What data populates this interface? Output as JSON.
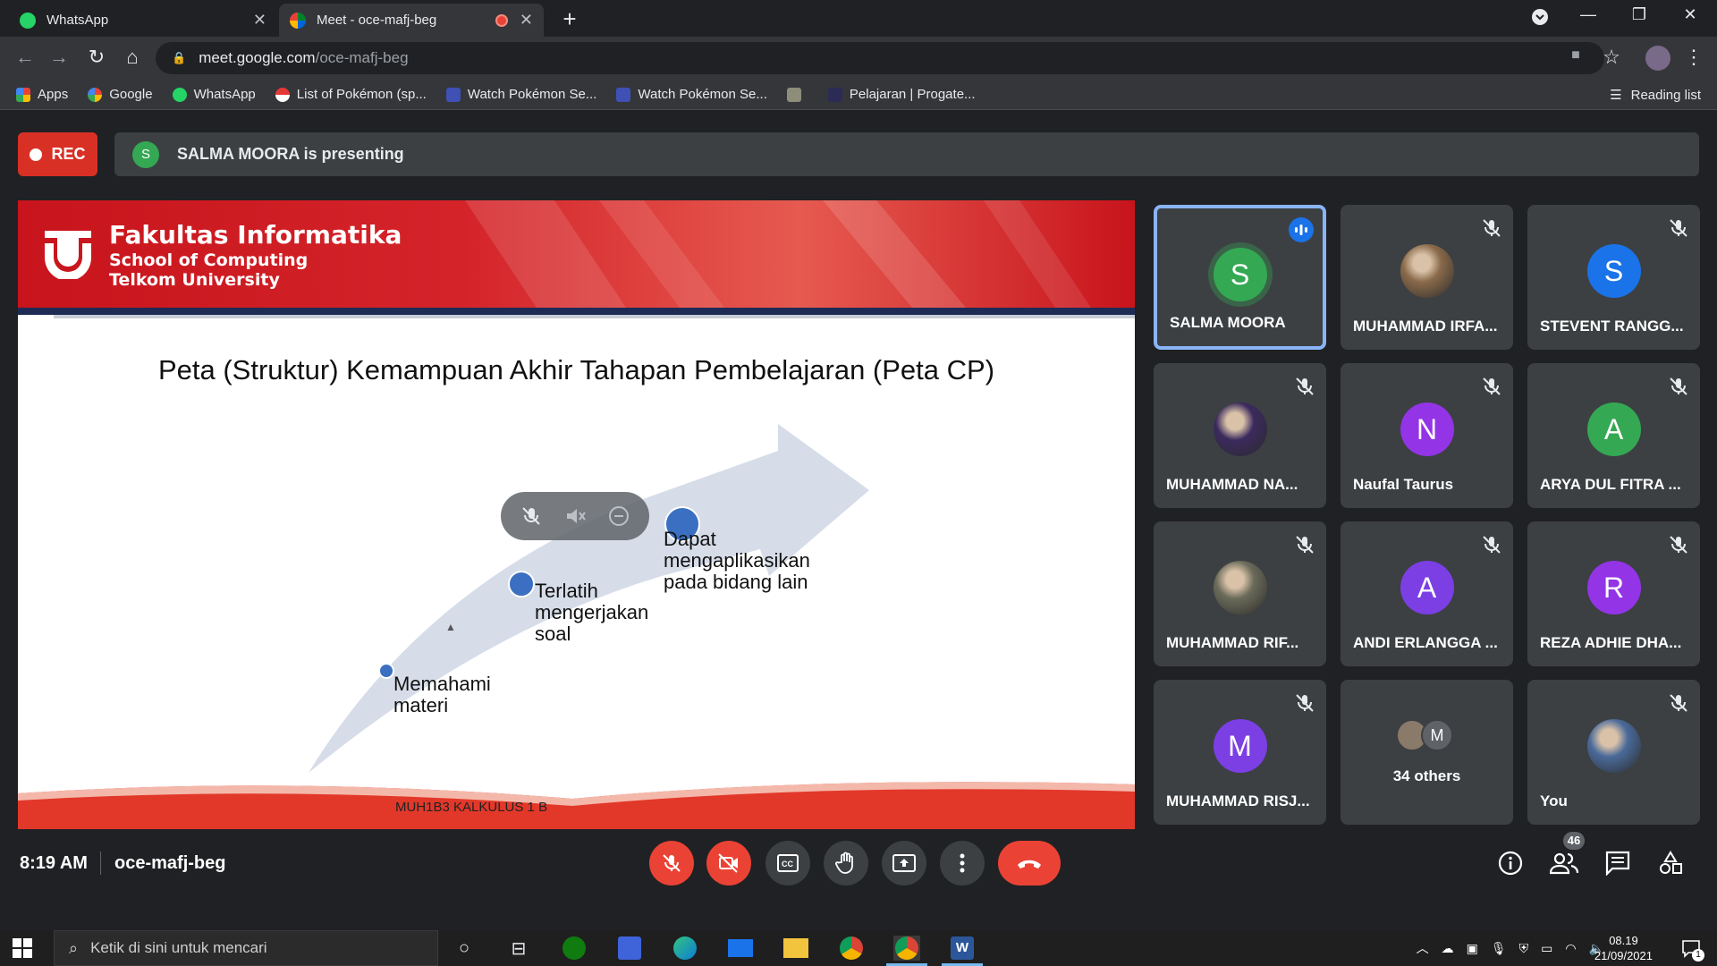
{
  "browser": {
    "tabs": [
      {
        "title": "WhatsApp",
        "active": false
      },
      {
        "title": "Meet - oce-mafj-beg",
        "active": true
      }
    ],
    "url_host": "meet.google.com",
    "url_path": "/oce-mafj-beg",
    "bookmarks": [
      {
        "label": "Apps",
        "icon": "apps-grid-icon"
      },
      {
        "label": "Google",
        "icon": "google-icon"
      },
      {
        "label": "WhatsApp",
        "icon": "whatsapp-icon"
      },
      {
        "label": "List of Pokémon (sp...",
        "icon": "pokeball-icon"
      },
      {
        "label": "Watch Pokémon Se...",
        "icon": "pokemon-tv-icon"
      },
      {
        "label": "Watch Pokémon Se...",
        "icon": "pokemon-tv-icon"
      },
      {
        "label": "",
        "icon": "image-favicon"
      },
      {
        "label": "Pelajaran | Progate...",
        "icon": "progate-icon"
      }
    ],
    "reading_list": "Reading list"
  },
  "meet": {
    "rec_label": "REC",
    "presenter_initial": "S",
    "presenting_text": "SALMA MOORA is presenting",
    "slide": {
      "faculty": "Fakultas Informatika",
      "school": "School of Computing",
      "university": "Telkom University",
      "title": "Peta (Struktur) Kemampuan Akhir Tahapan Pembelajaran (Peta CP)",
      "step1": [
        "Memahami",
        "materi"
      ],
      "step2": [
        "Terlatih",
        "mengerjakan",
        "soal"
      ],
      "step3": [
        "Dapat",
        "mengaplikasikan",
        "pada bidang lain"
      ],
      "footer": "MUH1B3 KALKULUS 1 B"
    },
    "participants": [
      {
        "name": "SALMA MOORA",
        "initial": "S",
        "color": "#34a853",
        "speaking": true
      },
      {
        "name": "MUHAMMAD IRFA...",
        "initial": "",
        "color": "#8a6a4a",
        "photo": true
      },
      {
        "name": "STEVENT RANGG...",
        "initial": "S",
        "color": "#1a73e8"
      },
      {
        "name": "MUHAMMAD NA...",
        "initial": "",
        "color": "#3b2a5e",
        "photo": true
      },
      {
        "name": "Naufal Taurus",
        "initial": "N",
        "color": "#9334e6"
      },
      {
        "name": "ARYA DUL FITRA ...",
        "initial": "A",
        "color": "#34a853"
      },
      {
        "name": "MUHAMMAD RIF...",
        "initial": "",
        "color": "#6b6b5a",
        "photo": true
      },
      {
        "name": "ANDI ERLANGGA ...",
        "initial": "A",
        "color": "#7b3fe4"
      },
      {
        "name": "REZA ADHIE DHA...",
        "initial": "R",
        "color": "#9334e6"
      },
      {
        "name": "MUHAMMAD RISJ...",
        "initial": "M",
        "color": "#7b3fe4"
      },
      {
        "name": "34 others",
        "initial": "M",
        "color": "#5f6368",
        "others": true
      },
      {
        "name": "You",
        "initial": "",
        "color": "#4a6a9a",
        "photo": true
      }
    ],
    "time": "8:19 AM",
    "meeting_code": "oce-mafj-beg",
    "participant_count": "46"
  },
  "taskbar": {
    "search_placeholder": "Ketik di sini untuk mencari",
    "time": "08.19",
    "date": "21/09/2021",
    "notification_count": "1"
  }
}
